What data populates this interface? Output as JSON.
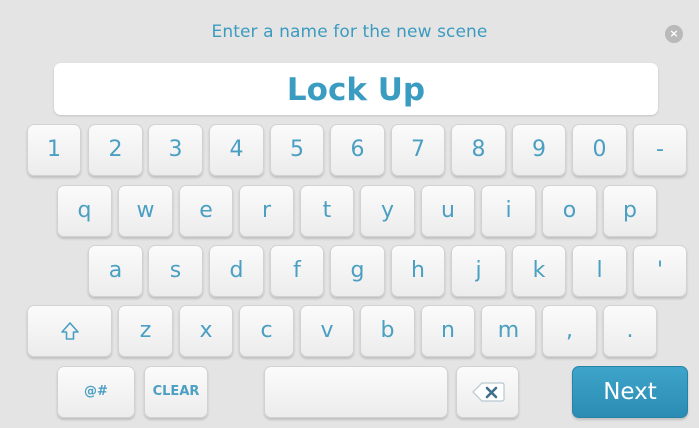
{
  "dialog": {
    "title": "Enter a name for the new scene",
    "close_icon": "close-icon",
    "name_value": "Lock Up"
  },
  "keyboard": {
    "row_numbers": [
      "1",
      "2",
      "3",
      "4",
      "5",
      "6",
      "7",
      "8",
      "9",
      "0",
      "-"
    ],
    "row_top": [
      "q",
      "w",
      "e",
      "r",
      "t",
      "y",
      "u",
      "i",
      "o",
      "p"
    ],
    "row_home": [
      "a",
      "s",
      "d",
      "f",
      "g",
      "h",
      "j",
      "k",
      "l",
      "'"
    ],
    "row_bottom": [
      "z",
      "x",
      "c",
      "v",
      "b",
      "n",
      "m",
      ",",
      "."
    ],
    "shift_icon": "shift-arrow-icon",
    "symbols_label": "@#",
    "clear_label": "CLEAR",
    "space_label": "",
    "backspace_icon": "backspace-icon",
    "next_label": "Next"
  },
  "colors": {
    "accent": "#3a9cc0",
    "next_button": "#2e90b8",
    "background": "#e4e4e4"
  }
}
